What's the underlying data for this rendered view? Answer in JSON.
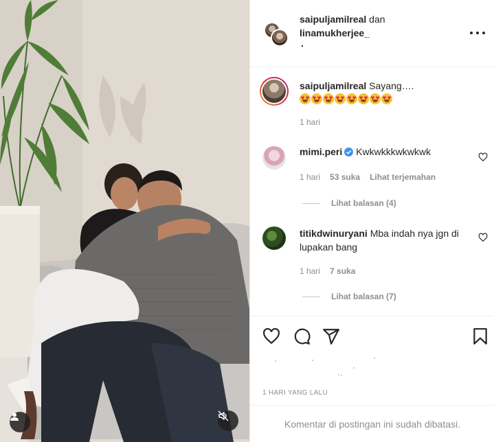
{
  "post": {
    "header": {
      "user1": "saipuljamilreal",
      "conjunction": "dan",
      "user2": "linamukherjee_",
      "subline": "."
    },
    "media": {
      "icons": {
        "tag": "user-tag-icon",
        "mute": "speaker-muted-icon"
      }
    },
    "caption": {
      "username": "saipuljamilreal",
      "text": "Sayang….",
      "emoji_count": 8,
      "age": "1 hari"
    },
    "comments": [
      {
        "username": "mimi.peri",
        "verified": true,
        "text": "Kwkwkkkwkwkwk",
        "age": "1 hari",
        "likes": "53 suka",
        "translate": "Lihat terjemahan",
        "replies": "Lihat balasan (4)"
      },
      {
        "username": "titikdwinuryani",
        "verified": false,
        "text": "Mba indah nya jgn di lupakan bang",
        "age": "1 hari",
        "likes": "7 suka",
        "replies": "Lihat balasan (7)"
      }
    ],
    "actions": {
      "icons": [
        "heart-icon",
        "comment-icon",
        "share-icon",
        "bookmark-icon"
      ]
    },
    "timestamp": "1 HARI YANG LALU",
    "comments_disabled": "Komentar di postingan ini sudah dibatasi."
  },
  "colors": {
    "text": "#262626",
    "muted": "#8e8e8e",
    "divider": "#efefef",
    "verified": "#3897f0"
  }
}
